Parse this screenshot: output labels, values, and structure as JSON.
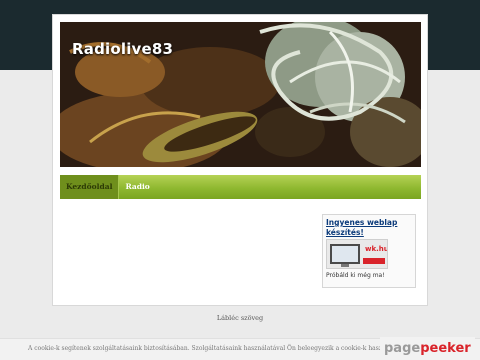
{
  "site": {
    "title": "Radiolive83"
  },
  "nav": {
    "items": [
      {
        "label": "Kezdőoldal",
        "active": true
      },
      {
        "label": "Radio",
        "active": false
      }
    ]
  },
  "widget": {
    "title": "Ingyenes weblap készítés!",
    "image_text": "wk.hu",
    "cta": "Próbáld ki még ma!"
  },
  "footer": {
    "text": "Lábléc szöveg"
  },
  "cookie": {
    "text": "A cookie-k segítenek szolgáltatásaink biztosításában. Szolgáltatásaink használatával Ön beleegyezik a cookie-k használat"
  },
  "badge": {
    "part1": "page",
    "part2": "peeker"
  },
  "colors": {
    "nav_green": "#8fb830",
    "top_band": "#1b2a2f",
    "link_blue": "#0b3a7a",
    "brand_red": "#d9232a"
  }
}
